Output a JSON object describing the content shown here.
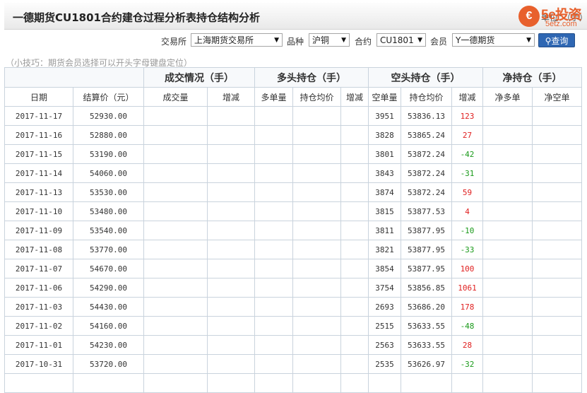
{
  "header": {
    "title": "一德期货CU1801合约建仓过程分析表持仓结构分析",
    "unit": "单位：（手）",
    "logo_main": "5e投资",
    "logo_sub": "5etz.com"
  },
  "filters": {
    "exchange_label": "交易所",
    "exchange_value": "上海期货交易所",
    "variety_label": "品种",
    "variety_value": "沪铜",
    "contract_label": "合约",
    "contract_value": "CU1801",
    "member_label": "会员",
    "member_value": "Y一德期货",
    "query_label": "查询"
  },
  "tip": "（小技巧：期货会员选择可以开头字母键盘定位）",
  "table": {
    "groups": [
      "成交情况（手）",
      "多头持仓（手）",
      "空头持仓（手）",
      "净持仓（手）"
    ],
    "columns": [
      "日期",
      "结算价（元）",
      "成交量",
      "增减",
      "多单量",
      "持仓均价",
      "增减",
      "空单量",
      "持仓均价",
      "增减",
      "净多单",
      "净空单"
    ],
    "rows": [
      {
        "date": "2017-11-17",
        "settle": "52930.00",
        "short_qty": "3951",
        "short_avg": "53836.13",
        "short_chg": "123",
        "dir": "up"
      },
      {
        "date": "2017-11-16",
        "settle": "52880.00",
        "short_qty": "3828",
        "short_avg": "53865.24",
        "short_chg": "27",
        "dir": "up"
      },
      {
        "date": "2017-11-15",
        "settle": "53190.00",
        "short_qty": "3801",
        "short_avg": "53872.24",
        "short_chg": "-42",
        "dir": "down"
      },
      {
        "date": "2017-11-14",
        "settle": "54060.00",
        "short_qty": "3843",
        "short_avg": "53872.24",
        "short_chg": "-31",
        "dir": "down"
      },
      {
        "date": "2017-11-13",
        "settle": "53530.00",
        "short_qty": "3874",
        "short_avg": "53872.24",
        "short_chg": "59",
        "dir": "up"
      },
      {
        "date": "2017-11-10",
        "settle": "53480.00",
        "short_qty": "3815",
        "short_avg": "53877.53",
        "short_chg": "4",
        "dir": "up"
      },
      {
        "date": "2017-11-09",
        "settle": "53540.00",
        "short_qty": "3811",
        "short_avg": "53877.95",
        "short_chg": "-10",
        "dir": "down"
      },
      {
        "date": "2017-11-08",
        "settle": "53770.00",
        "short_qty": "3821",
        "short_avg": "53877.95",
        "short_chg": "-33",
        "dir": "down"
      },
      {
        "date": "2017-11-07",
        "settle": "54670.00",
        "short_qty": "3854",
        "short_avg": "53877.95",
        "short_chg": "100",
        "dir": "up"
      },
      {
        "date": "2017-11-06",
        "settle": "54290.00",
        "short_qty": "3754",
        "short_avg": "53856.85",
        "short_chg": "1061",
        "dir": "up"
      },
      {
        "date": "2017-11-03",
        "settle": "54430.00",
        "short_qty": "2693",
        "short_avg": "53686.20",
        "short_chg": "178",
        "dir": "up"
      },
      {
        "date": "2017-11-02",
        "settle": "54160.00",
        "short_qty": "2515",
        "short_avg": "53633.55",
        "short_chg": "-48",
        "dir": "down"
      },
      {
        "date": "2017-11-01",
        "settle": "54230.00",
        "short_qty": "2563",
        "short_avg": "53633.55",
        "short_chg": "28",
        "dir": "up"
      },
      {
        "date": "2017-10-31",
        "settle": "53720.00",
        "short_qty": "2535",
        "short_avg": "53626.97",
        "short_chg": "-32",
        "dir": "down"
      },
      {
        "date": "",
        "settle": "",
        "short_qty": "",
        "short_avg": "",
        "short_chg": "",
        "dir": "up"
      }
    ]
  },
  "colors": {
    "up": "#e02020",
    "down": "#1a9a1a",
    "button": "#2f67b3",
    "logo": "#e8602c"
  }
}
